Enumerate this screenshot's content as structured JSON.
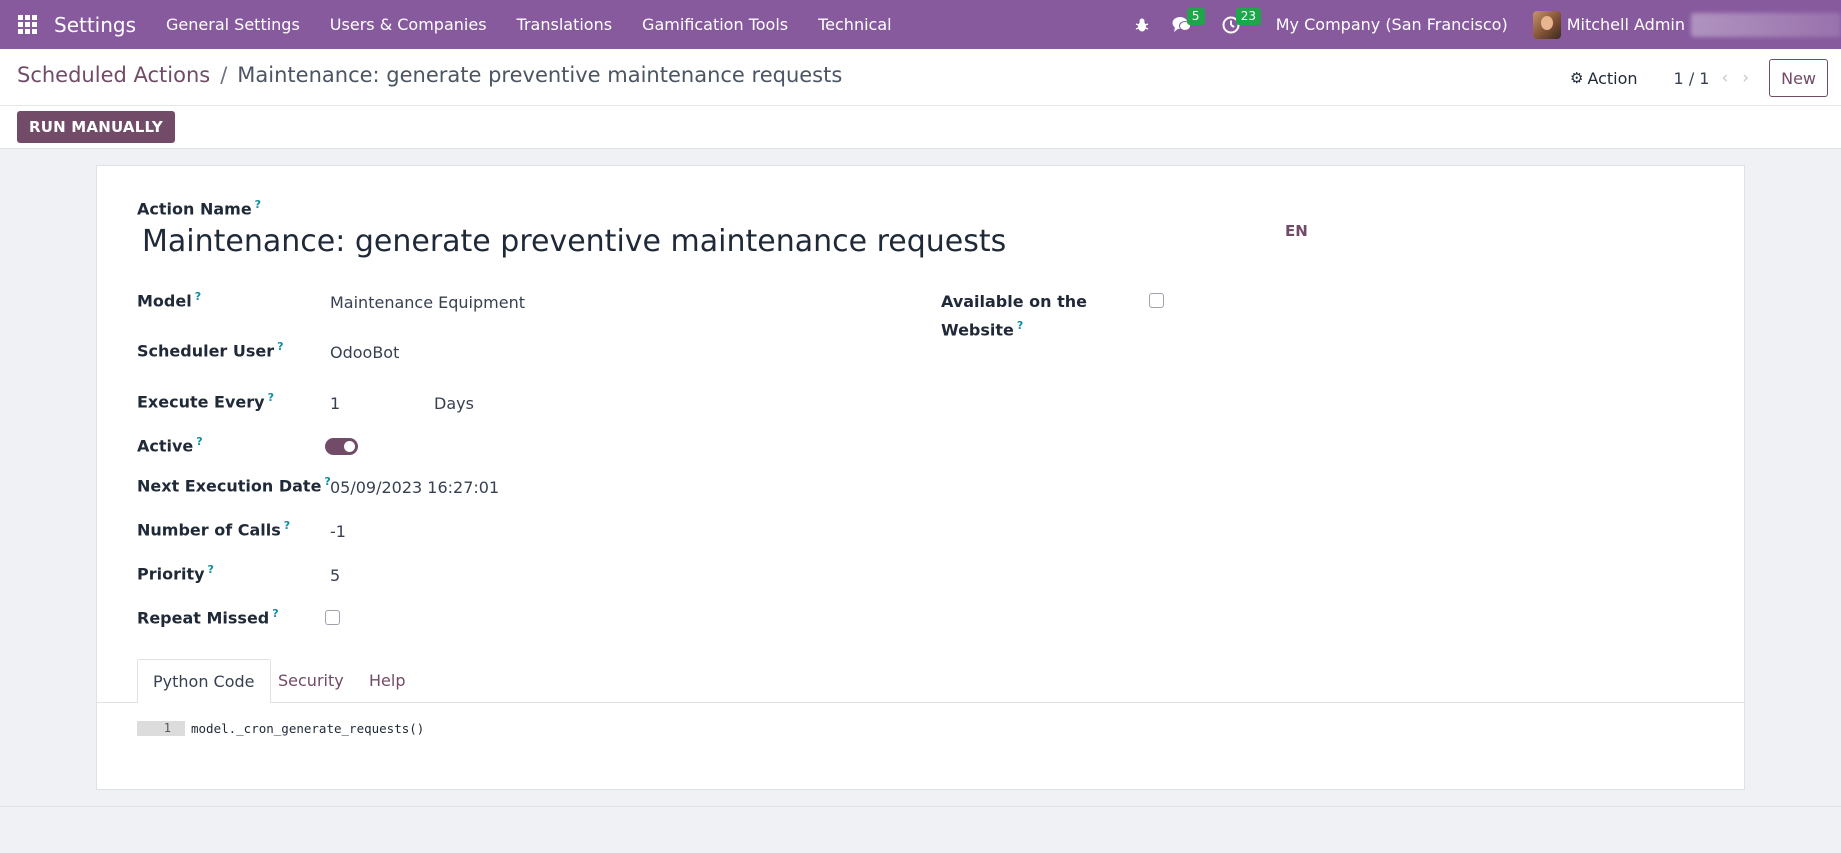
{
  "colors": {
    "navbar": "#875a9e",
    "primary": "#714b67",
    "badge": "#1fa64b",
    "help": "#0d8ea0"
  },
  "navbar": {
    "brand": "Settings",
    "menu": [
      "General Settings",
      "Users & Companies",
      "Translations",
      "Gamification Tools",
      "Technical"
    ],
    "messages_badge": "5",
    "activities_badge": "23",
    "company": "My Company (San Francisco)",
    "user": "Mitchell Admin"
  },
  "control": {
    "breadcrumb_parent": "Scheduled Actions",
    "breadcrumb_separator": "/",
    "breadcrumb_current": "Maintenance: generate preventive maintenance requests",
    "action_label": "Action",
    "pager": "1 / 1",
    "new_label": "New",
    "run_label": "RUN MANUALLY"
  },
  "form": {
    "help_mark": "?",
    "action_name_label": "Action Name",
    "action_name_value": "Maintenance: generate preventive maintenance requests",
    "lang": "EN",
    "model_label": "Model",
    "model_value": "Maintenance Equipment",
    "scheduler_user_label": "Scheduler User",
    "scheduler_user_value": "OdooBot",
    "execute_every_label": "Execute Every",
    "execute_every_number": "1",
    "execute_every_unit": "Days",
    "active_label": "Active",
    "next_execution_label": "Next Execution Date",
    "next_execution_value": "05/09/2023 16:27:01",
    "number_of_calls_label": "Number of Calls",
    "number_of_calls_value": "-1",
    "priority_label": "Priority",
    "priority_value": "5",
    "repeat_missed_label": "Repeat Missed",
    "available_website_label_line1": "Available on the",
    "available_website_label_line2": "Website",
    "tabs": [
      "Python Code",
      "Security",
      "Help"
    ],
    "code_line_number": "1",
    "code_line": "model._cron_generate_requests()"
  }
}
